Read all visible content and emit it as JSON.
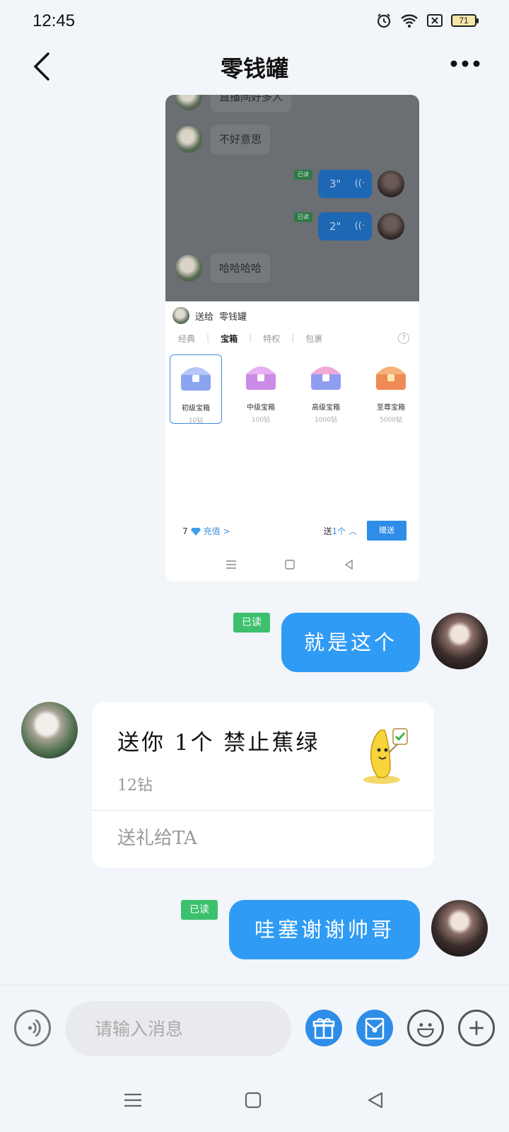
{
  "status": {
    "time": "12:45",
    "battery": "71"
  },
  "header": {
    "title": "零钱罐"
  },
  "screenshot": {
    "messages": [
      {
        "text": "直播间好多人"
      },
      {
        "text": "不好意思"
      },
      {
        "duration": "3\"",
        "read": "已读"
      },
      {
        "duration": "2\"",
        "read": "已读"
      },
      {
        "text": "哈哈哈哈"
      }
    ],
    "panel": {
      "to_label": "送给",
      "to_name": "零钱罐",
      "tabs": [
        "经典",
        "宝箱",
        "特权",
        "包裹"
      ],
      "active_tab": "宝箱",
      "gifts": [
        {
          "name": "初级宝箱",
          "price": "10钻",
          "color": "#8aa4f0"
        },
        {
          "name": "中级宝箱",
          "price": "100钻",
          "color": "#c98be6"
        },
        {
          "name": "高级宝箱",
          "price": "1000钻",
          "color": "#8f9df0"
        },
        {
          "name": "至尊宝箱",
          "price": "5000钻",
          "color": "#ef8a55"
        }
      ],
      "balance": "7",
      "recharge": "充值 >",
      "send_count_prefix": "送",
      "send_count": "1个",
      "send_button": "赠送"
    }
  },
  "chat": {
    "read_label": "已读",
    "msg1": "就是这个",
    "gift_card": {
      "title": "送你 1个 禁止蕉绿",
      "price": "12钻",
      "link": "送礼给TA"
    },
    "msg2": "哇塞谢谢帅哥"
  },
  "input": {
    "placeholder": "请输入消息"
  },
  "colors": {
    "accent": "#2f9bf4",
    "read_badge": "#3cc06e"
  }
}
